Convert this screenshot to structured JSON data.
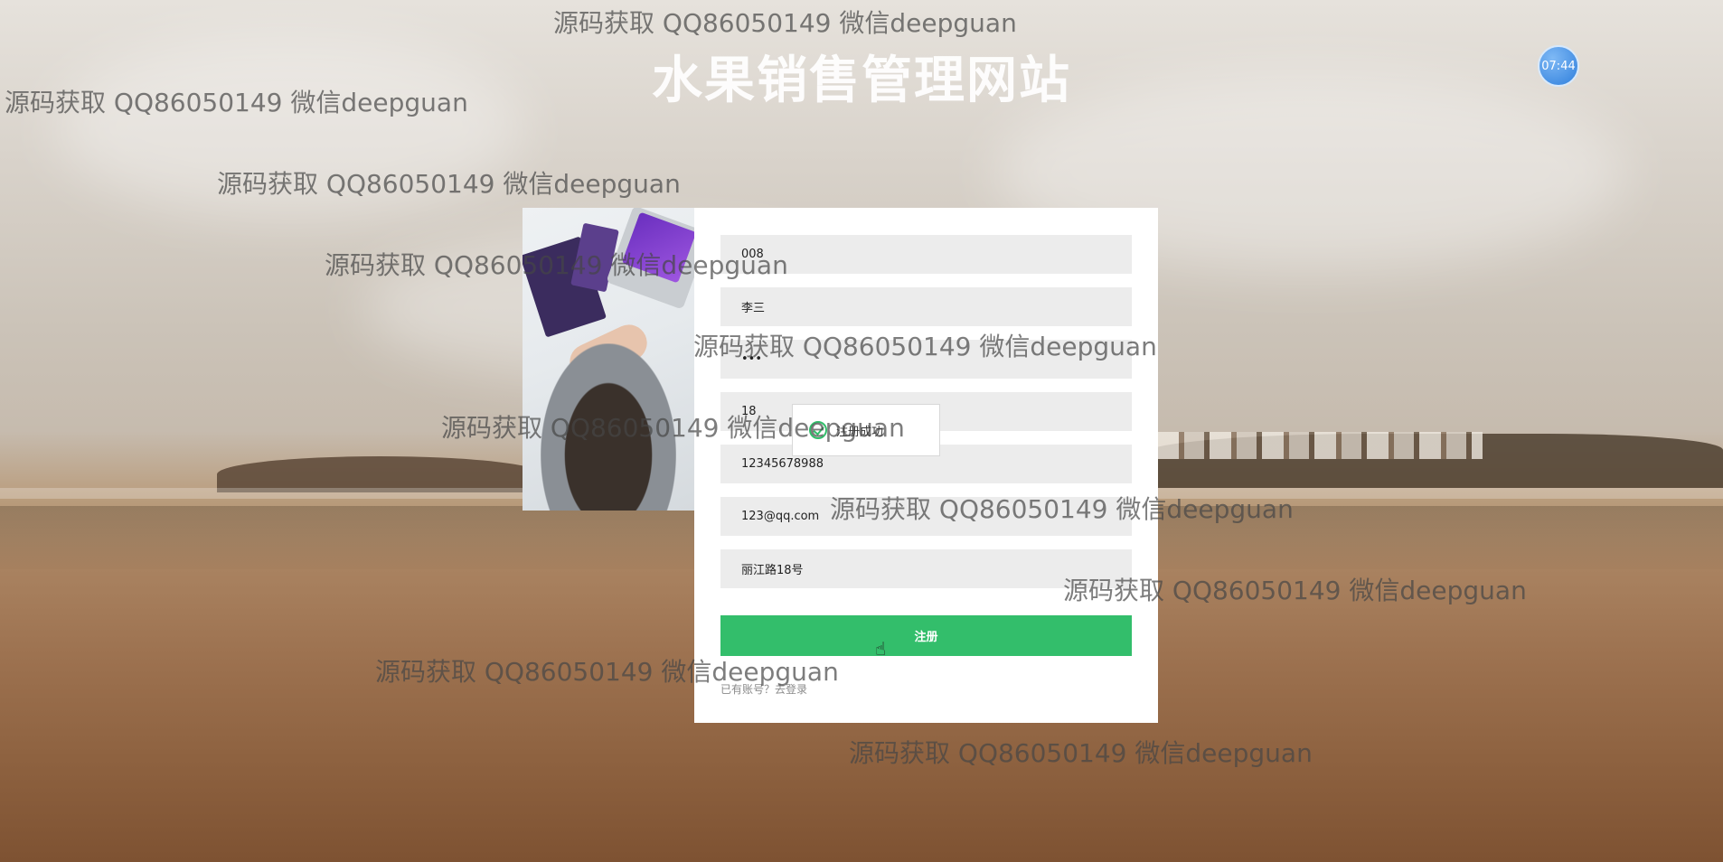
{
  "site": {
    "title": "水果销售管理网站",
    "clock": "07:44"
  },
  "form": {
    "fields": [
      {
        "name": "account",
        "value": "008"
      },
      {
        "name": "name",
        "value": "李三"
      },
      {
        "name": "password",
        "value": "•••"
      },
      {
        "name": "age",
        "value": "18"
      },
      {
        "name": "phone",
        "value": "12345678988"
      },
      {
        "name": "email",
        "value": "123@qq.com"
      },
      {
        "name": "address",
        "value": "丽江路18号"
      }
    ],
    "submit_label": "注册",
    "login_link": "已有账号？去登录"
  },
  "toast": {
    "message": "注册成功"
  },
  "watermark": {
    "text": "源码获取 QQ86050149 微信deepguan"
  },
  "colors": {
    "accent": "#33be6b",
    "field_bg": "#ececec",
    "clock": "#2f7fdc"
  }
}
